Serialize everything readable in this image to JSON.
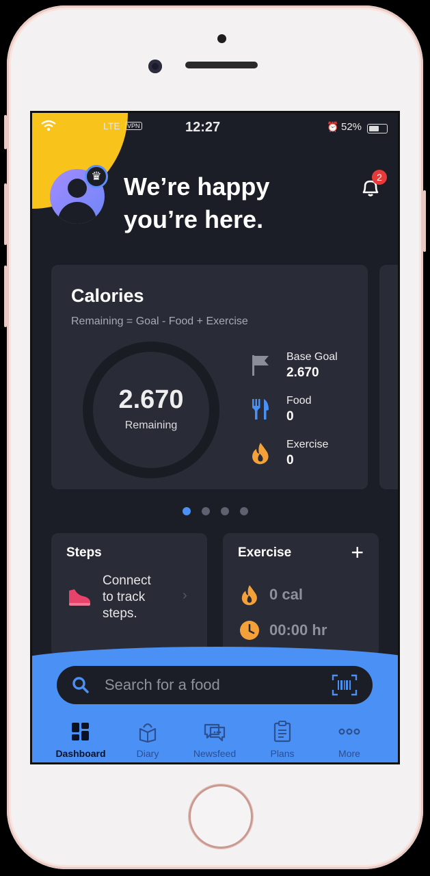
{
  "status_bar": {
    "network": "LTE",
    "vpn": "VPN",
    "time": "12:27",
    "battery": "52%"
  },
  "header": {
    "greeting_line1": "We’re happy",
    "greeting_line2": "you’re here.",
    "notification_count": "2"
  },
  "calories_card": {
    "title": "Calories",
    "formula": "Remaining = Goal - Food + Exercise",
    "remaining_value": "2.670",
    "remaining_label": "Remaining",
    "stats": [
      {
        "label": "Base Goal",
        "value": "2.670",
        "icon": "flag-icon"
      },
      {
        "label": "Food",
        "value": "0",
        "icon": "fork-knife-icon"
      },
      {
        "label": "Exercise",
        "value": "0",
        "icon": "flame-icon"
      }
    ]
  },
  "carousel": {
    "page_count": 4,
    "active_index": 0
  },
  "steps_card": {
    "title": "Steps",
    "text": [
      "Connect",
      "to track",
      "steps."
    ]
  },
  "exercise_card": {
    "title": "Exercise",
    "calories": "0 cal",
    "duration": "00:00 hr"
  },
  "search": {
    "placeholder": "Search for a food"
  },
  "nav": [
    {
      "label": "Dashboard",
      "icon": "dashboard-icon",
      "active": true
    },
    {
      "label": "Diary",
      "icon": "diary-icon",
      "active": false
    },
    {
      "label": "Newsfeed",
      "icon": "newsfeed-icon",
      "active": false
    },
    {
      "label": "Plans",
      "icon": "plans-icon",
      "active": false
    },
    {
      "label": "More",
      "icon": "more-icon",
      "active": false
    }
  ],
  "colors": {
    "accent": "#4a90f5",
    "brand_yellow": "#f8c31a",
    "orange": "#f5a13a",
    "background": "#1c1e27",
    "card": "#292b36"
  }
}
